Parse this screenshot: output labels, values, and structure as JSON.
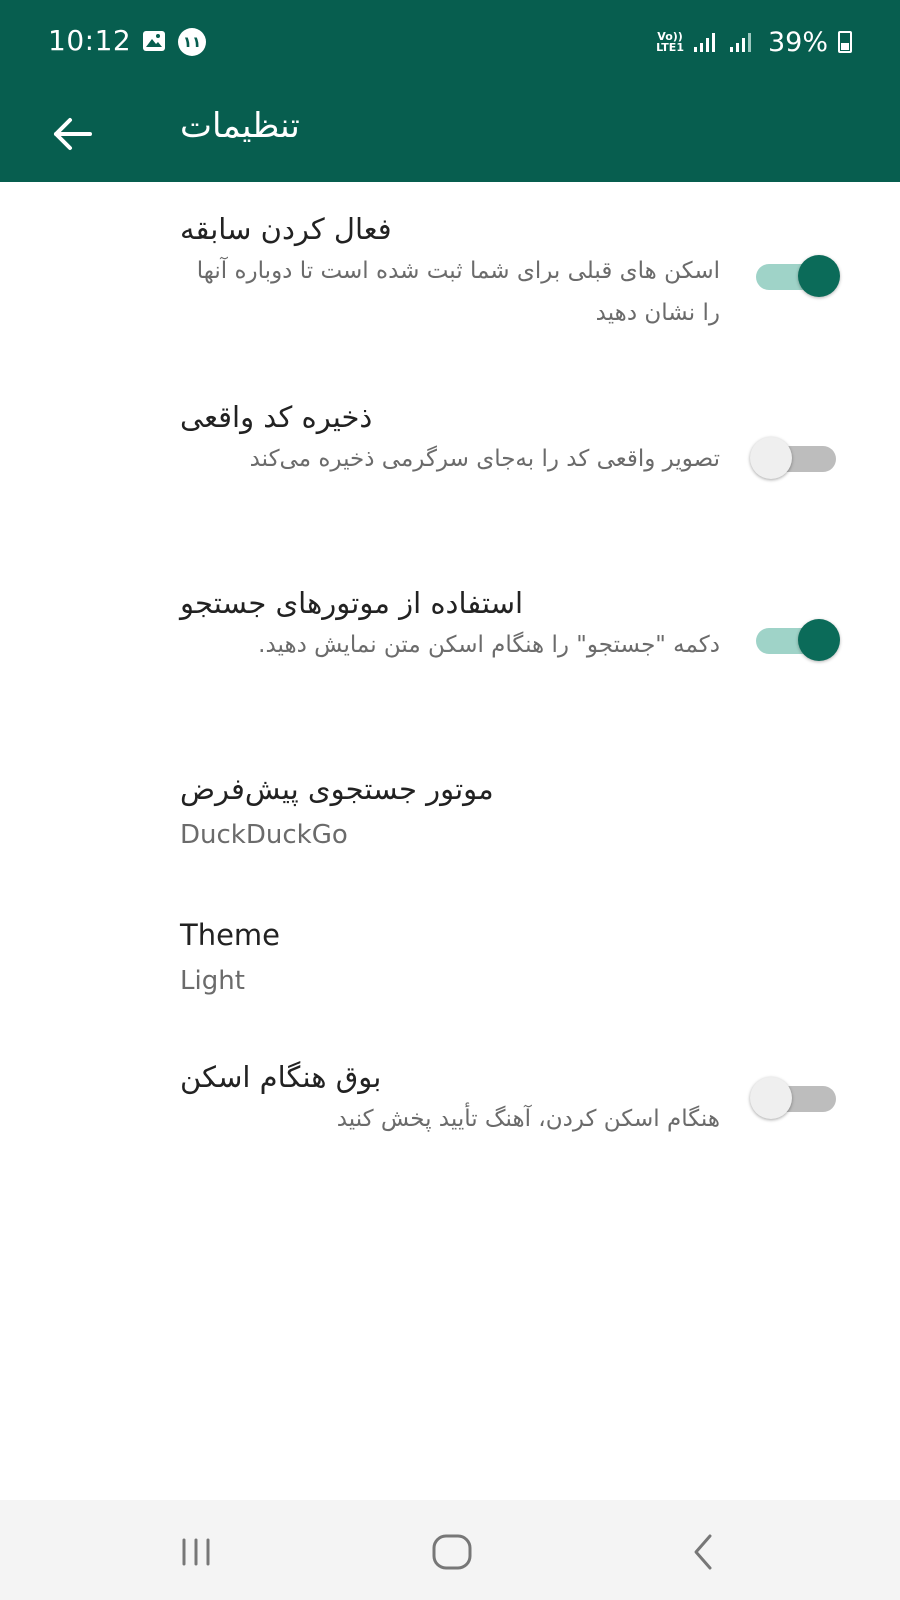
{
  "status_bar": {
    "time": "10:12",
    "notification_badge": "۱۱",
    "volte_line1": "Vo))",
    "volte_line2": "LTE1",
    "battery": "39%"
  },
  "app_bar": {
    "title": "تنظیمات",
    "back_icon": "arrow-back-icon"
  },
  "settings": [
    {
      "title": "فعال کردن سابقه",
      "description": "اسکن های قبلی برای شما ثبت شده است تا دوباره آنها را نشان دهید",
      "toggle": true
    },
    {
      "title": "ذخیره کد واقعی",
      "description": "تصویر واقعی کد را به‌جای سرگرمی ذخیره می‌کند",
      "toggle": false
    },
    {
      "title": "استفاده از موتورهای جستجو",
      "description": "دکمه \"جستجو\" را هنگام اسکن متن نمایش دهید.",
      "toggle": true
    },
    {
      "title": "موتور جستجوی پیش‌فرض",
      "value": "DuckDuckGo"
    },
    {
      "title": "Theme",
      "value": "Light"
    },
    {
      "title": "بوق هنگام اسکن",
      "description": "هنگام اسکن کردن، آهنگ تأیید پخش کنید",
      "toggle": false
    }
  ],
  "nav_bar": {
    "recents_icon": "recents-icon",
    "home_icon": "home-icon",
    "back_icon": "nav-back-icon"
  },
  "colors": {
    "primary": "#075e4f",
    "toggle_on": "#0b6b59",
    "toggle_on_track": "#9fd3c8"
  }
}
